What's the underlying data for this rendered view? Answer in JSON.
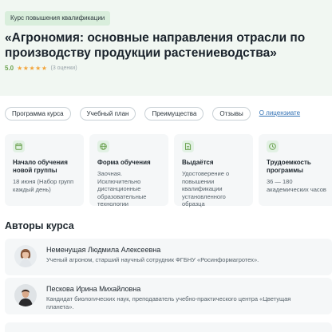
{
  "hero": {
    "badge": "Курс повышения квалификации",
    "title": "«Агрономия: основные направления отрасли по производству продукции растениеводства»",
    "rating": {
      "score": "5.0",
      "stars": "★★★★★",
      "count": "(3 оценки)"
    }
  },
  "tabs": [
    {
      "label": "Программа курса"
    },
    {
      "label": "Учебный план"
    },
    {
      "label": "Преимущества"
    },
    {
      "label": "Отзывы"
    }
  ],
  "license_link": "О лицензиате",
  "cards": [
    {
      "icon": "calendar-icon",
      "title": "Начало обучения новой группы",
      "text": "18 июня (Набор групп каждый день)"
    },
    {
      "icon": "globe-icon",
      "title": "Форма обучения",
      "text": "Заочная. Исключительно дистанционные образовательные технологии"
    },
    {
      "icon": "document-icon",
      "title": "Выдаётся",
      "text": "Удостоверение о повышении квалификации установленного образца"
    },
    {
      "icon": "clock-icon",
      "title": "Трудоемкость программы",
      "text": "36 — 180 академических часов"
    }
  ],
  "authors_section": {
    "title": "Авторы курса",
    "authors": [
      {
        "name": "Неменущая Людмила Алексеевна",
        "desc": "Ученый агроном, старший научный сотрудник ФГБНУ «Росинформагротех»."
      },
      {
        "name": "Пескова Ирина Михайловна",
        "desc": "Кандидат биологических наук, преподаватель учебно-практического центра «Цветущая планета»."
      }
    ]
  },
  "colors": {
    "accent": "#6ba24f",
    "hero_bg": "#f1f7f2",
    "card_bg": "#f5f7f8",
    "link": "#2f6fb3",
    "star": "#f2a43a"
  }
}
